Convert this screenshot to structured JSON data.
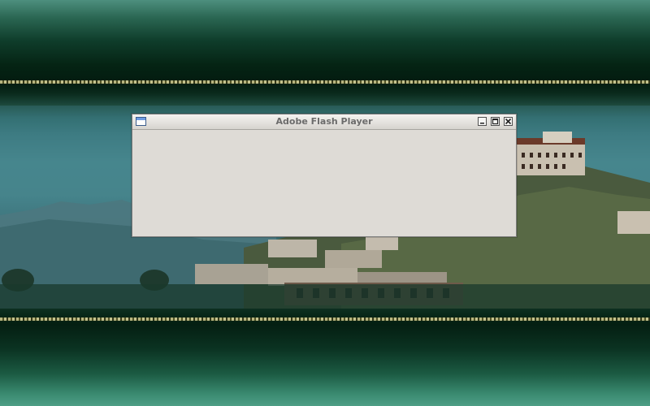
{
  "window": {
    "title": "Adobe Flash Player",
    "icon": "app-window-icon",
    "controls": {
      "minimize": "minimize-icon",
      "maximize": "maximize-icon",
      "close": "close-icon"
    }
  },
  "desktop": {
    "wallpaper": "potala-palace-landscape",
    "colors": {
      "dark_green": "#031c10",
      "teal": "#4b8c93",
      "window_bg": "#dedbd6",
      "band_gold": "#c9c48a"
    }
  }
}
